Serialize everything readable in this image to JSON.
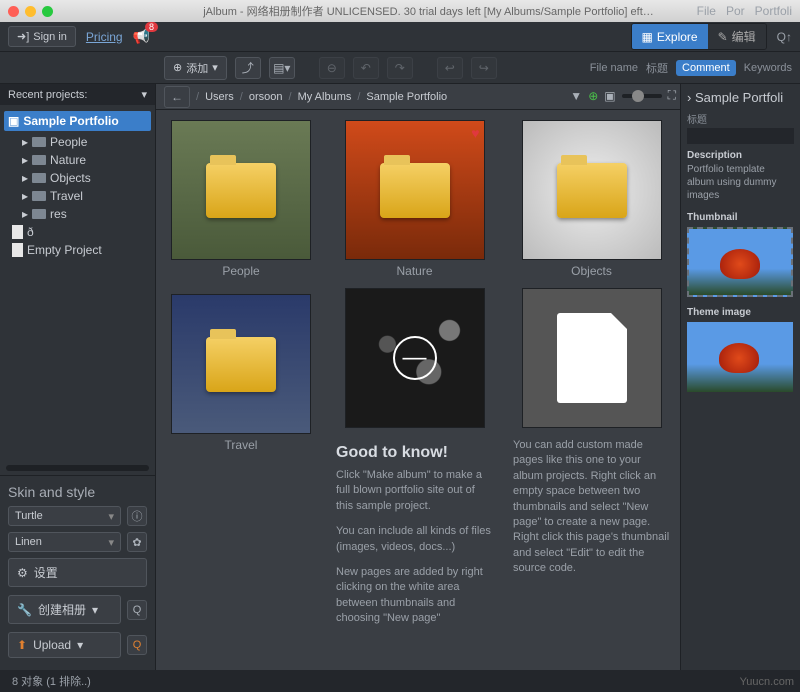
{
  "titlebar": "jAlbum - 网络相册制作者 UNLICENSED. 30 trial days left [My Albums/Sample Portfolio]  eft…",
  "top_tabs": [
    "File",
    "Por",
    "Portfoli"
  ],
  "topbar": {
    "signin": "Sign in",
    "pricing": "Pricing",
    "notif_count": "8"
  },
  "mode": {
    "explore": "Explore",
    "edit": "编辑"
  },
  "meta": {
    "filename": "File name",
    "title": "标题",
    "comment": "Comment",
    "keywords": "Keywords"
  },
  "toolbar": {
    "add": "添加"
  },
  "recent_header": "Recent projects:",
  "tree": {
    "root": "Sample Portfolio",
    "children": [
      "People",
      "Nature",
      "Objects",
      "Travel",
      "res"
    ],
    "extras": [
      "ð",
      "Empty Project"
    ]
  },
  "skin": {
    "title": "Skin and style",
    "theme": "Turtle",
    "style": "Linen"
  },
  "actions": {
    "settings": "设置",
    "makealbum": "创建相册",
    "upload": "Upload"
  },
  "path": [
    "Users",
    "orsoon",
    "My Albums",
    "Sample Portfolio"
  ],
  "thumbs": [
    {
      "label": "People",
      "bg": "bg-people",
      "fav": false,
      "folder": true
    },
    {
      "label": "Nature",
      "bg": "bg-nature",
      "fav": true,
      "folder": true
    },
    {
      "label": "Objects",
      "bg": "bg-objects",
      "fav": false,
      "folder": true
    },
    {
      "label": "Travel",
      "bg": "bg-travel",
      "fav": false,
      "folder": true
    }
  ],
  "info": {
    "title": "Good to know!",
    "p1": "Click \"Make album\" to make a full blown portfolio site out of this sample project.",
    "p2": "You can include all kinds of files (images, videos, docs...)",
    "p3": "New pages are added by right clicking on the white area between thumbnails and choosing \"New page\"",
    "custom": "You can add custom made pages like this one to your album projects. Right click an empty space between two thumbnails and select \"New page\" to create a new page. Right click this page's thumbnail and select \"Edit\" to edit the source code."
  },
  "rpanel": {
    "title": "Sample Portfoli",
    "title_label": "标题",
    "desc_label": "Description",
    "desc": "Portfolio template album using dummy images",
    "thumb_label": "Thumbnail",
    "theme_label": "Theme image"
  },
  "status": "8 对象 (1 排除..)",
  "watermark": "Yuucn.com"
}
